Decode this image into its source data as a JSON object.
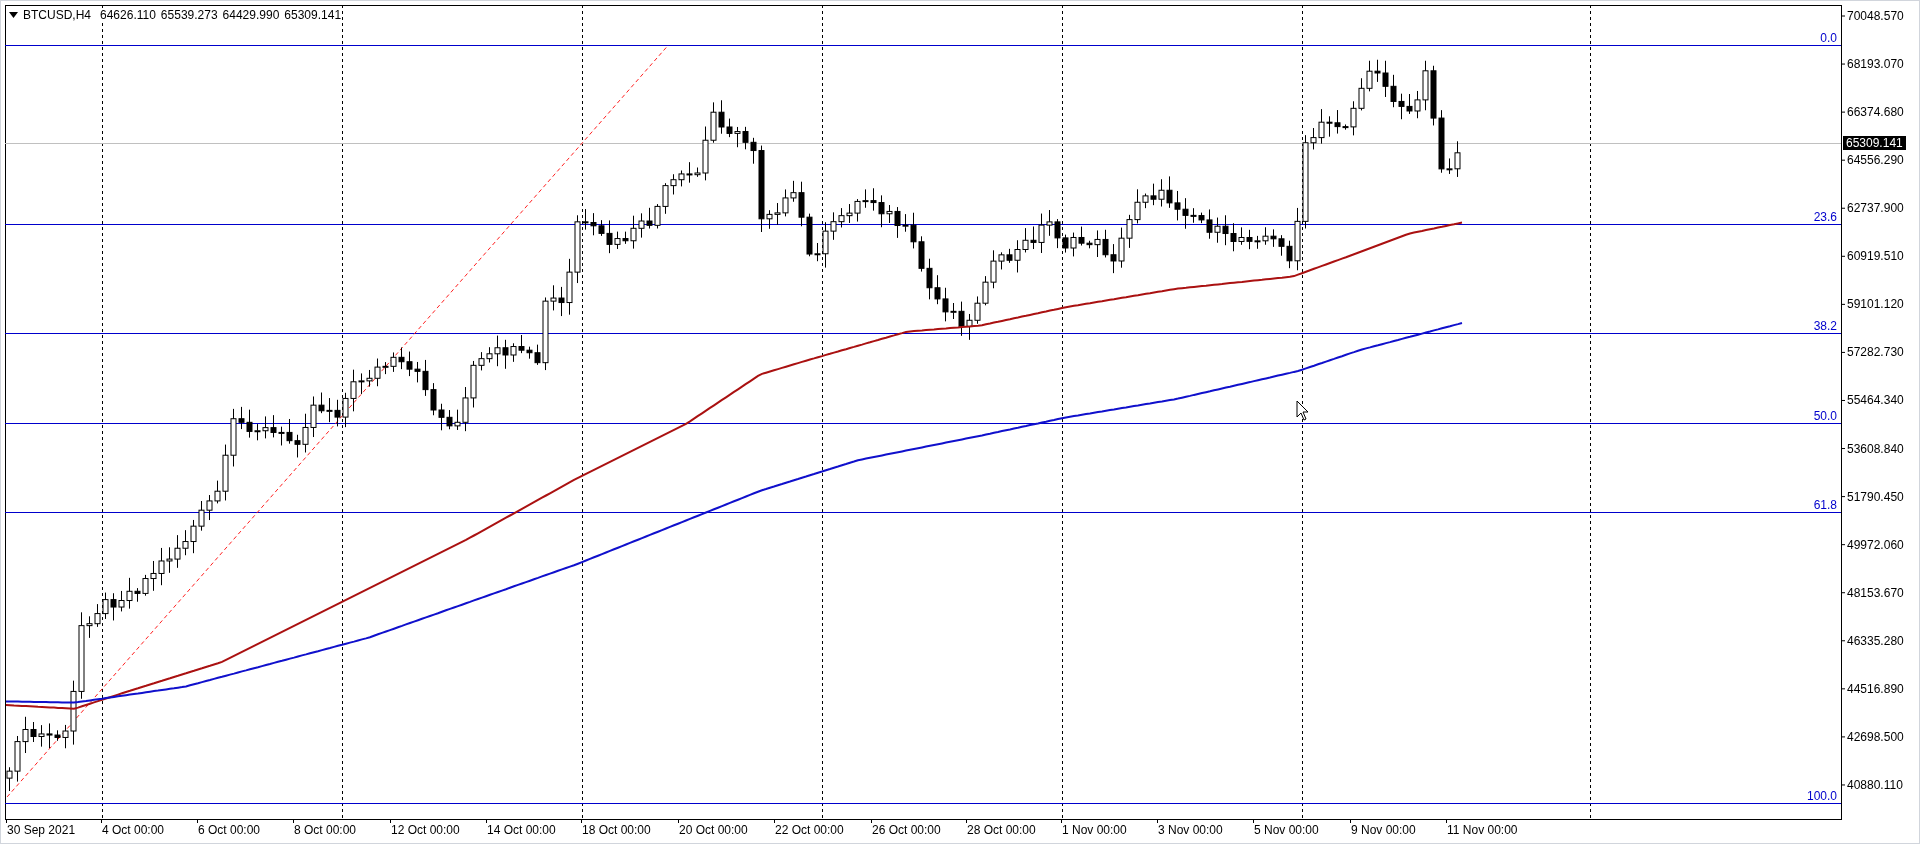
{
  "header": {
    "symbol": "BTCUSD,H4",
    "ohlc": [
      "64626.110",
      "65539.273",
      "64429.990",
      "65309.141"
    ]
  },
  "price_axis": {
    "labels": [
      "70048.570",
      "68193.070",
      "66374.680",
      "64556.290",
      "62737.900",
      "60919.510",
      "59101.120",
      "57282.730",
      "55464.340",
      "53608.840",
      "51790.450",
      "49972.060",
      "48153.670",
      "46335.280",
      "44516.890",
      "42698.500",
      "40880.110"
    ],
    "current_price": "65309.141"
  },
  "time_axis": {
    "labels": [
      "30 Sep 2021",
      "4 Oct 00:00",
      "6 Oct 00:00",
      "8 Oct 00:00",
      "12 Oct 00:00",
      "14 Oct 00:00",
      "18 Oct 00:00",
      "20 Oct 00:00",
      "22 Oct 00:00",
      "26 Oct 00:00",
      "28 Oct 00:00",
      "1 Nov 00:00",
      "3 Nov 00:00",
      "5 Nov 00:00",
      "9 Nov 00:00",
      "11 Nov 00:00"
    ]
  },
  "fibonacci": {
    "levels": [
      "0.0",
      "23.6",
      "38.2",
      "50.0",
      "61.8",
      "100.0"
    ]
  }
}
